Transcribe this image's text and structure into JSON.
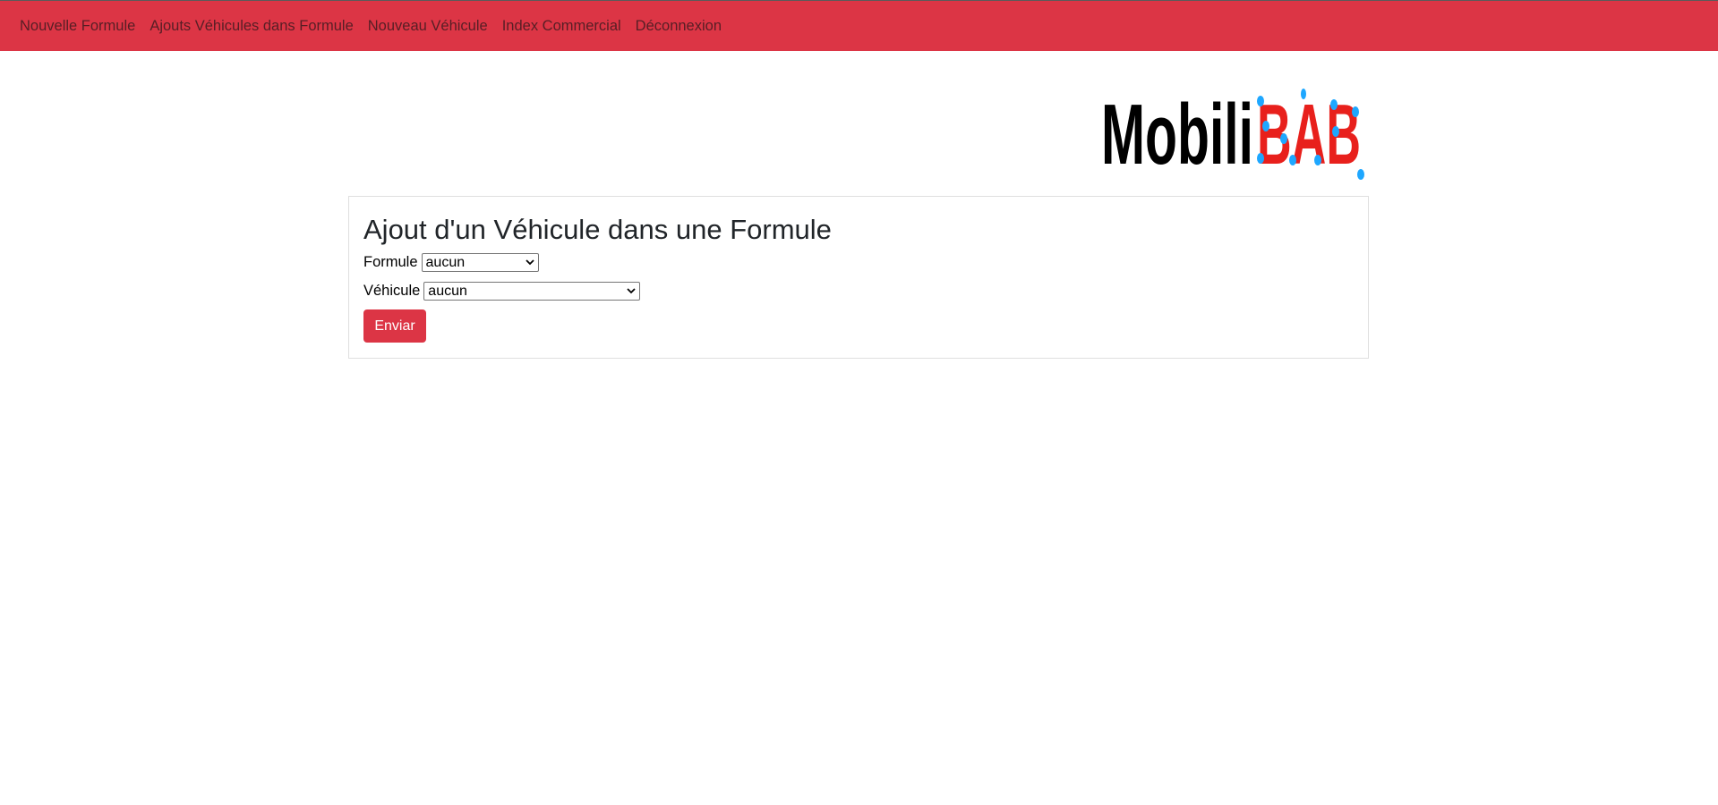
{
  "nav": {
    "items": [
      {
        "label": "Nouvelle Formule"
      },
      {
        "label": "Ajouts Véhicules dans Formule"
      },
      {
        "label": "Nouveau Véhicule"
      },
      {
        "label": "Index Commercial"
      },
      {
        "label": "Déconnexion"
      }
    ]
  },
  "logo": {
    "text_dark": "Mobili",
    "text_red": "BAB"
  },
  "form": {
    "title": "Ajout d'un Véhicule dans une Formule",
    "formule_label": "Formule",
    "formule_value": "aucun",
    "vehicule_label": "Véhicule",
    "vehicule_value": "aucun",
    "submit_label": "Enviar"
  },
  "colors": {
    "accent": "#dc3545",
    "logo_dots": "#1ea7ff",
    "logo_red": "#e8201c"
  }
}
